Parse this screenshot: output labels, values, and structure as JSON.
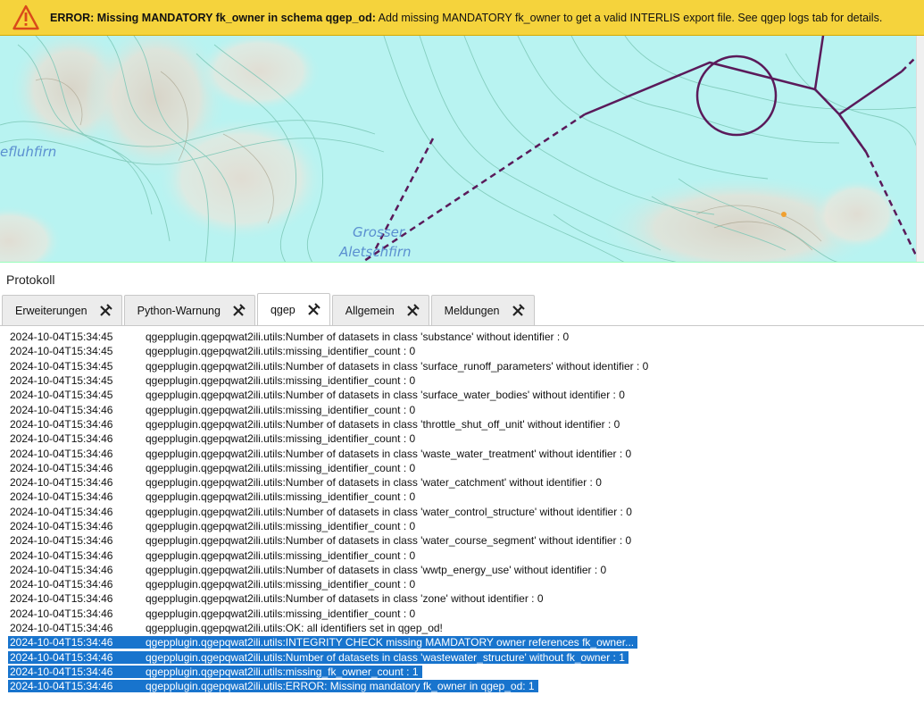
{
  "banner": {
    "icon": "warning-icon",
    "bold_text": "ERROR: Missing MANDATORY fk_owner in schema qgep_od:",
    "text": "Add missing MANDATORY fk_owner to get a valid INTERLIS export file. See qgep logs tab for details.",
    "color": "#f5d33c"
  },
  "map": {
    "labels": [
      "efluhfirn",
      "Grosser",
      "Aletschfirn"
    ],
    "water_color": "#b8f3f1",
    "line_color": "#5a1a5a"
  },
  "panel": {
    "title": "Protokoll"
  },
  "tabs": [
    {
      "label": "Erweiterungen",
      "active": false
    },
    {
      "label": "Python-Warnung",
      "active": false
    },
    {
      "label": "qgep",
      "active": true
    },
    {
      "label": "Allgemein",
      "active": false
    },
    {
      "label": "Meldungen",
      "active": false
    }
  ],
  "log": {
    "selection_color": "#1874cd",
    "rows": [
      {
        "ts": "2024-10-04T15:34:45",
        "msg": "qgepplugin.qgepqwat2ili.utils:Number of datasets in class 'substance' without identifier : 0",
        "selected": false
      },
      {
        "ts": "2024-10-04T15:34:45",
        "msg": "qgepplugin.qgepqwat2ili.utils:missing_identifier_count : 0",
        "selected": false
      },
      {
        "ts": "2024-10-04T15:34:45",
        "msg": "qgepplugin.qgepqwat2ili.utils:Number of datasets in class 'surface_runoff_parameters' without identifier : 0",
        "selected": false
      },
      {
        "ts": "2024-10-04T15:34:45",
        "msg": "qgepplugin.qgepqwat2ili.utils:missing_identifier_count : 0",
        "selected": false
      },
      {
        "ts": "2024-10-04T15:34:45",
        "msg": "qgepplugin.qgepqwat2ili.utils:Number of datasets in class 'surface_water_bodies' without identifier : 0",
        "selected": false
      },
      {
        "ts": "2024-10-04T15:34:46",
        "msg": "qgepplugin.qgepqwat2ili.utils:missing_identifier_count : 0",
        "selected": false
      },
      {
        "ts": "2024-10-04T15:34:46",
        "msg": "qgepplugin.qgepqwat2ili.utils:Number of datasets in class 'throttle_shut_off_unit' without identifier : 0",
        "selected": false
      },
      {
        "ts": "2024-10-04T15:34:46",
        "msg": "qgepplugin.qgepqwat2ili.utils:missing_identifier_count : 0",
        "selected": false
      },
      {
        "ts": "2024-10-04T15:34:46",
        "msg": "qgepplugin.qgepqwat2ili.utils:Number of datasets in class 'waste_water_treatment' without identifier : 0",
        "selected": false
      },
      {
        "ts": "2024-10-04T15:34:46",
        "msg": "qgepplugin.qgepqwat2ili.utils:missing_identifier_count : 0",
        "selected": false
      },
      {
        "ts": "2024-10-04T15:34:46",
        "msg": "qgepplugin.qgepqwat2ili.utils:Number of datasets in class 'water_catchment' without identifier : 0",
        "selected": false
      },
      {
        "ts": "2024-10-04T15:34:46",
        "msg": "qgepplugin.qgepqwat2ili.utils:missing_identifier_count : 0",
        "selected": false
      },
      {
        "ts": "2024-10-04T15:34:46",
        "msg": "qgepplugin.qgepqwat2ili.utils:Number of datasets in class 'water_control_structure' without identifier : 0",
        "selected": false
      },
      {
        "ts": "2024-10-04T15:34:46",
        "msg": "qgepplugin.qgepqwat2ili.utils:missing_identifier_count : 0",
        "selected": false
      },
      {
        "ts": "2024-10-04T15:34:46",
        "msg": "qgepplugin.qgepqwat2ili.utils:Number of datasets in class 'water_course_segment' without identifier : 0",
        "selected": false
      },
      {
        "ts": "2024-10-04T15:34:46",
        "msg": "qgepplugin.qgepqwat2ili.utils:missing_identifier_count : 0",
        "selected": false
      },
      {
        "ts": "2024-10-04T15:34:46",
        "msg": "qgepplugin.qgepqwat2ili.utils:Number of datasets in class 'wwtp_energy_use' without identifier : 0",
        "selected": false
      },
      {
        "ts": "2024-10-04T15:34:46",
        "msg": "qgepplugin.qgepqwat2ili.utils:missing_identifier_count : 0",
        "selected": false
      },
      {
        "ts": "2024-10-04T15:34:46",
        "msg": "qgepplugin.qgepqwat2ili.utils:Number of datasets in class 'zone' without identifier : 0",
        "selected": false
      },
      {
        "ts": "2024-10-04T15:34:46",
        "msg": "qgepplugin.qgepqwat2ili.utils:missing_identifier_count : 0",
        "selected": false
      },
      {
        "ts": "2024-10-04T15:34:46",
        "msg": "qgepplugin.qgepqwat2ili.utils:OK: all identifiers set in qgep_od!",
        "selected": false
      },
      {
        "ts": "2024-10-04T15:34:46",
        "msg": "qgepplugin.qgepqwat2ili.utils:INTEGRITY CHECK missing MAMDATORY owner references fk_owner...",
        "selected": true
      },
      {
        "ts": "2024-10-04T15:34:46",
        "msg": "qgepplugin.qgepqwat2ili.utils:Number of datasets in class 'wastewater_structure' without fk_owner : 1",
        "selected": true
      },
      {
        "ts": "2024-10-04T15:34:46",
        "msg": "qgepplugin.qgepqwat2ili.utils:missing_fk_owner_count : 1",
        "selected": true
      },
      {
        "ts": "2024-10-04T15:34:46",
        "msg": "qgepplugin.qgepqwat2ili.utils:ERROR: Missing mandatory fk_owner in qgep_od: 1",
        "selected": true
      }
    ]
  }
}
